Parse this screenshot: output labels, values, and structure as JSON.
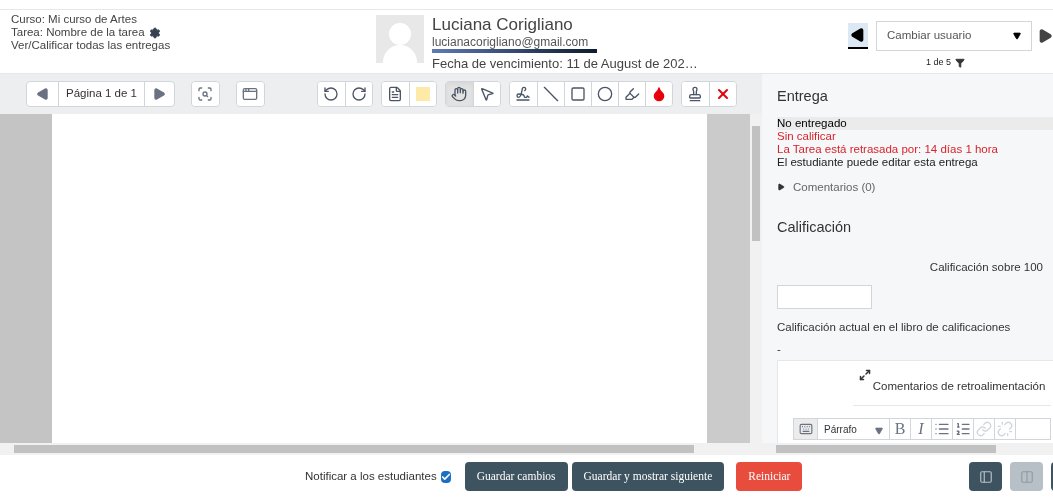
{
  "header": {
    "course": "Curso: Mi curso de Artes",
    "task": "Tarea: Nombre de la tarea",
    "view_all": "Ver/Calificar todas las entregas",
    "user_name": "Luciana Corigliano",
    "email": "lucianacorigliano@gmail.com",
    "due_date": "Fecha de vencimiento: 11 de August de 202…",
    "user_select": {
      "placeholder": "Cambiar usuario"
    },
    "counter": "1 de 5"
  },
  "toolbar": {
    "page_label": "Página 1 de 1",
    "groups": [
      [
        {
          "kind": "search-page",
          "selected": false
        }
      ],
      [
        {
          "kind": "expand",
          "selected": false
        }
      ],
      [
        {
          "kind": "rotate-left",
          "selected": false
        },
        {
          "kind": "rotate-right",
          "selected": false
        }
      ],
      [
        {
          "kind": "comment",
          "selected": false
        },
        {
          "kind": "color",
          "selected": false
        }
      ],
      [
        {
          "kind": "hand",
          "selected": true
        },
        {
          "kind": "pointer",
          "selected": false
        }
      ],
      [
        {
          "kind": "pen",
          "selected": false
        },
        {
          "kind": "line",
          "selected": false
        },
        {
          "kind": "rectangle",
          "selected": false
        },
        {
          "kind": "oval",
          "selected": false
        },
        {
          "kind": "highlighter",
          "selected": false
        },
        {
          "kind": "drop",
          "selected": false
        }
      ],
      [
        {
          "kind": "stamp",
          "selected": false
        },
        {
          "kind": "delete",
          "selected": false
        }
      ]
    ]
  },
  "submission": {
    "title": "Entrega",
    "status_lines": [
      {
        "text": "No entregado",
        "kind": "highlight"
      },
      {
        "text": "Sin calificar",
        "kind": "alert"
      },
      {
        "text": "La Tarea está retrasada por: 14 días 1 hora",
        "kind": "alert"
      },
      {
        "text": "El estudiante puede editar esta entrega",
        "kind": "normal"
      }
    ],
    "comments": {
      "label": "Comentarios (0)",
      "expanded": false
    }
  },
  "grade": {
    "title": "Calificación",
    "grade_label": "Calificación sobre 100",
    "current_label": "Calificación actual en el libro de calificaciones",
    "current_value": "-",
    "feedback_label": "Comentarios de retroalimentación",
    "editor": {
      "format": "Párrafo",
      "buttons": [
        {
          "kind": "bold",
          "label": "B"
        },
        {
          "kind": "italic",
          "label": "I"
        },
        {
          "kind": "bullets"
        },
        {
          "kind": "numbers"
        },
        {
          "kind": "link"
        },
        {
          "kind": "unlink"
        }
      ]
    }
  },
  "footer": {
    "notify_label": "Notificar a los estudiantes",
    "notify_checked": true,
    "buttons": [
      {
        "label": "Guardar cambios",
        "kind": "primary"
      },
      {
        "label": "Guardar y mostrar siguiente",
        "kind": "primary"
      },
      {
        "label": "Reiniciar",
        "kind": "danger"
      }
    ],
    "layouts": [
      {
        "selected": false
      },
      {
        "selected": true
      },
      {
        "selected": false
      }
    ]
  }
}
